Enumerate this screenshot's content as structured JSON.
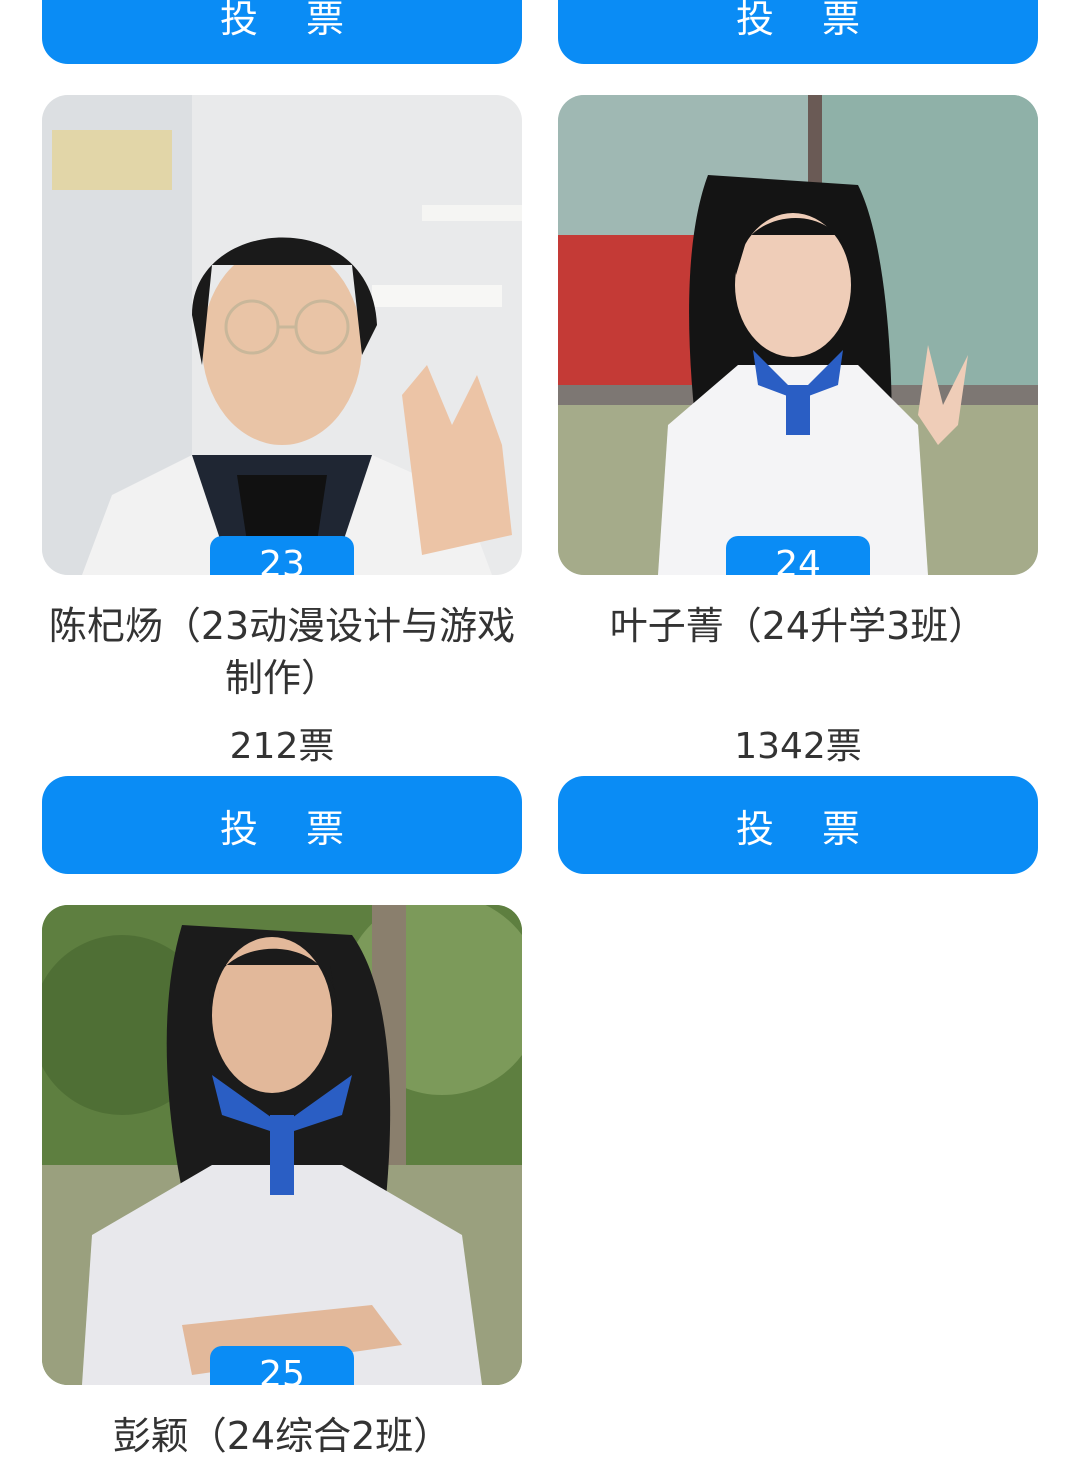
{
  "vote_label": "投 票",
  "candidates": [
    {
      "number": "23",
      "name": "陈杞炀（23动漫设计与游戏制作）",
      "votes": "212票",
      "photo": "candidate-photo-boy-glasses-peace-sign"
    },
    {
      "number": "24",
      "name": "叶子菁（24升学3班）",
      "votes": "1342票",
      "photo": "candidate-photo-girl-window-peace-sign"
    },
    {
      "number": "25",
      "name": "彭颖（24综合2班）",
      "photo": "candidate-photo-girl-trees-arms-crossed"
    }
  ],
  "colors": {
    "accent": "#0a8cf5",
    "text": "#333333",
    "background": "#ffffff"
  }
}
